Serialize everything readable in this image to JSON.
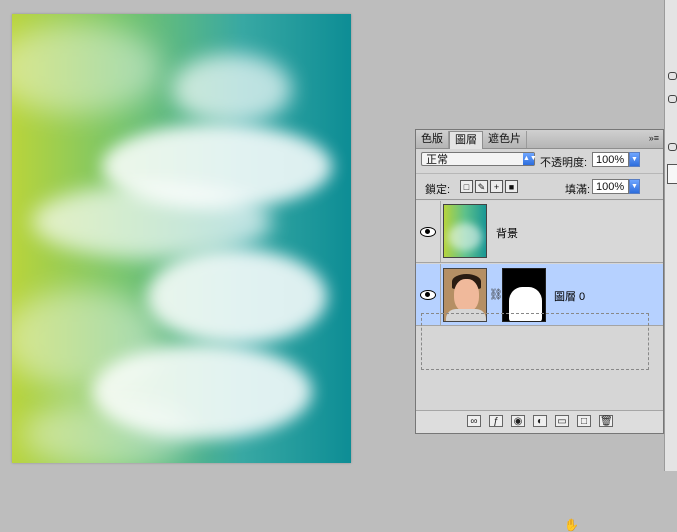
{
  "layers_panel": {
    "tabs": [
      "色版",
      "圖層",
      "遮色片"
    ],
    "active_tab": "圖層",
    "panel_menu_icon": "»≡",
    "blend_mode": "正常",
    "opacity_label": "不透明度:",
    "opacity_value": "100%",
    "lock_label": "鎖定:",
    "fill_label": "填滿:",
    "fill_value": "100%",
    "layers": [
      {
        "name": "背景"
      },
      {
        "name": "圖層 0"
      }
    ],
    "bottom_icons": [
      "link-icon",
      "fx-icon",
      "mask-icon",
      "adjustment-icon",
      "group-icon",
      "new-layer-icon",
      "trash-icon"
    ]
  }
}
